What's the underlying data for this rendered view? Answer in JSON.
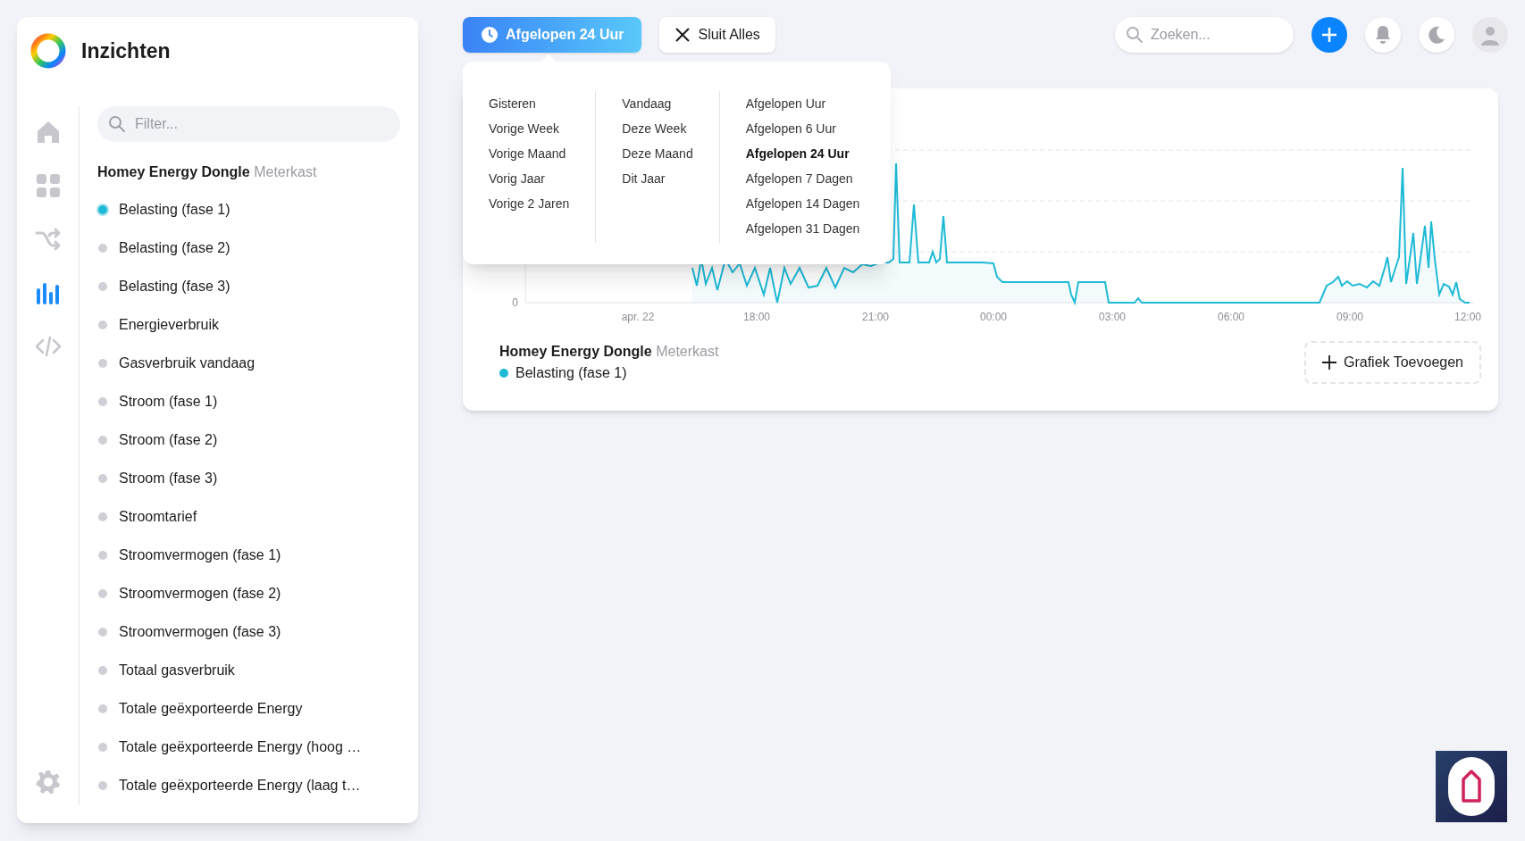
{
  "sidebar": {
    "title": "Inzichten",
    "nav": [
      {
        "kind": "home",
        "selected": false
      },
      {
        "kind": "grid",
        "selected": false
      },
      {
        "kind": "flow",
        "selected": false
      },
      {
        "kind": "insights",
        "selected": true
      },
      {
        "kind": "code",
        "selected": false
      }
    ],
    "filter": {
      "placeholder": "Filter..."
    },
    "device": {
      "name": "Homey Energy Dongle",
      "zone": "Meterkast"
    },
    "items": [
      {
        "label": "Belasting (fase 1)",
        "selected": true
      },
      {
        "label": "Belasting (fase 2)",
        "selected": false
      },
      {
        "label": "Belasting (fase 3)",
        "selected": false
      },
      {
        "label": "Energieverbruik",
        "selected": false
      },
      {
        "label": "Gasverbruik vandaag",
        "selected": false
      },
      {
        "label": "Stroom (fase 1)",
        "selected": false
      },
      {
        "label": "Stroom (fase 2)",
        "selected": false
      },
      {
        "label": "Stroom (fase 3)",
        "selected": false
      },
      {
        "label": "Stroomtarief",
        "selected": false
      },
      {
        "label": "Stroomvermogen (fase 1)",
        "selected": false
      },
      {
        "label": "Stroomvermogen (fase 2)",
        "selected": false
      },
      {
        "label": "Stroomvermogen (fase 3)",
        "selected": false
      },
      {
        "label": "Totaal gasverbruik",
        "selected": false
      },
      {
        "label": "Totale geëxporteerde Energy",
        "selected": false
      },
      {
        "label": "Totale geëxporteerde Energy (hoog …",
        "selected": false
      },
      {
        "label": "Totale geëxporteerde Energy (laag t…",
        "selected": false
      }
    ]
  },
  "toolbar": {
    "time_button": "Afgelopen 24 Uur",
    "close_all": "Sluit Alles",
    "search": {
      "placeholder": "Zoeken..."
    }
  },
  "dropdown": {
    "columns": [
      [
        {
          "label": "Gisteren",
          "selected": false
        },
        {
          "label": "Vorige Week",
          "selected": false
        },
        {
          "label": "Vorige Maand",
          "selected": false
        },
        {
          "label": "Vorig Jaar",
          "selected": false
        },
        {
          "label": "Vorige 2 Jaren",
          "selected": false
        }
      ],
      [
        {
          "label": "Vandaag",
          "selected": false
        },
        {
          "label": "Deze Week",
          "selected": false
        },
        {
          "label": "Deze Maand",
          "selected": false
        },
        {
          "label": "Dit Jaar",
          "selected": false
        }
      ],
      [
        {
          "label": "Afgelopen Uur",
          "selected": false
        },
        {
          "label": "Afgelopen 6 Uur",
          "selected": false
        },
        {
          "label": "Afgelopen 24 Uur",
          "selected": true
        },
        {
          "label": "Afgelopen 7 Dagen",
          "selected": false
        },
        {
          "label": "Afgelopen 14 Dagen",
          "selected": false
        },
        {
          "label": "Afgelopen 31 Dagen",
          "selected": false
        }
      ]
    ]
  },
  "chart": {
    "y_tick_labels": [
      "0"
    ],
    "x_tick_labels": [
      "apr. 22",
      "18:00",
      "21:00",
      "00:00",
      "03:00",
      "06:00",
      "09:00",
      "12:00"
    ],
    "legend": {
      "device": "Homey Energy Dongle",
      "zone": "Meterkast",
      "series": "Belasting (fase 1)"
    },
    "add_button": "Grafiek Toevoegen"
  }
}
